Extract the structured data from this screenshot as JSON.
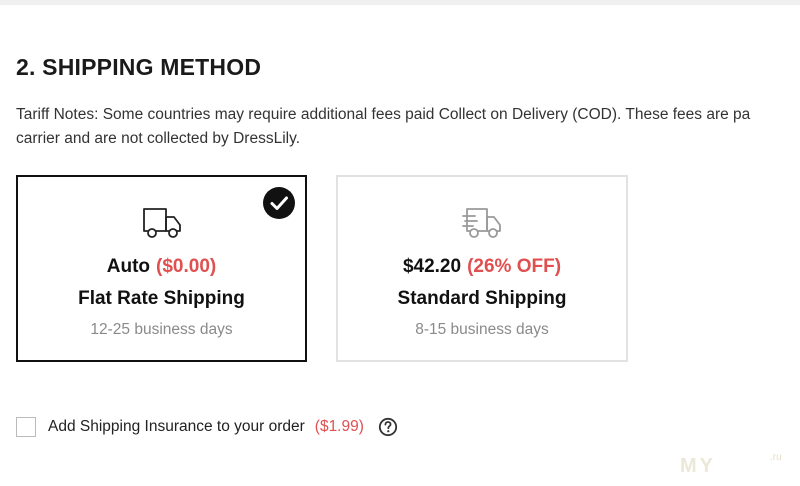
{
  "section": {
    "title": "2. SHIPPING METHOD",
    "notes_line1": "Tariff Notes: Some countries may require additional fees paid Collect on Delivery (COD). These fees are pa",
    "notes_line2": "carrier and are not collected by DressLily."
  },
  "options": [
    {
      "price": "Auto",
      "accent": "($0.00)",
      "name": "Flat Rate Shipping",
      "days": "12-25 business days",
      "selected": true,
      "icon": "truck-icon"
    },
    {
      "price": "$42.20",
      "accent": "(26% OFF)",
      "name": "Standard Shipping",
      "days": "8-15 business days",
      "selected": false,
      "icon": "truck-fast-icon"
    }
  ],
  "insurance": {
    "label": "Add Shipping Insurance to your order",
    "price": "($1.99)",
    "checked": false,
    "help_icon": "question-circle-icon"
  },
  "watermark": {
    "text": "MY",
    "suffix": ".ru"
  },
  "colors": {
    "accent": "#e05050",
    "selected_border": "#111111",
    "unselected_border": "#e2e2e2",
    "muted_text": "#8a8a8a"
  }
}
